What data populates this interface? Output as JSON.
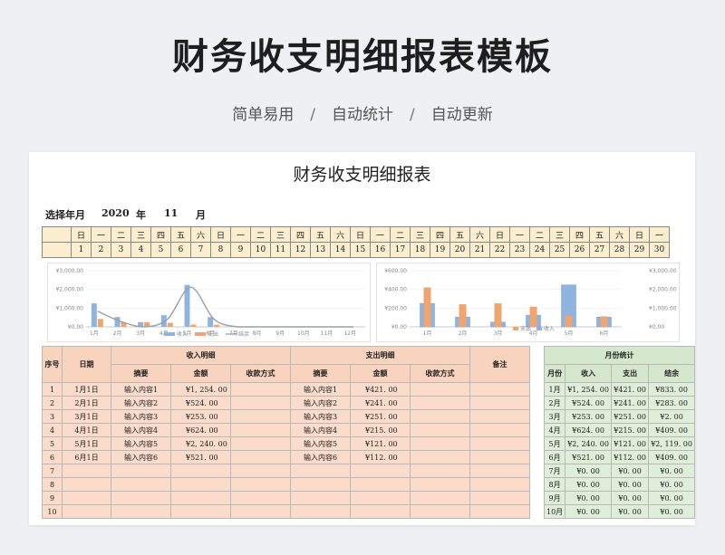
{
  "hero": {
    "title": "财务收支明细报表模板",
    "tags": [
      "简单易用",
      "自动统计",
      "自动更新"
    ],
    "separator": "/"
  },
  "sheet": {
    "title": "财务收支明细报表",
    "picker": {
      "label": "选择年月",
      "year": "2020",
      "year_unit": "年",
      "month": "11",
      "month_unit": "月"
    }
  },
  "calendar": {
    "weekdays": [
      "日",
      "一",
      "二",
      "三",
      "四",
      "五",
      "六",
      "日",
      "一",
      "二",
      "三",
      "四",
      "五",
      "六",
      "日",
      "一",
      "二",
      "三",
      "四",
      "五",
      "六",
      "日",
      "一",
      "二",
      "三",
      "四",
      "五",
      "六",
      "日",
      "一"
    ],
    "days": [
      "1",
      "2",
      "3",
      "4",
      "5",
      "6",
      "7",
      "8",
      "9",
      "10",
      "11",
      "12",
      "13",
      "14",
      "15",
      "16",
      "17",
      "18",
      "19",
      "20",
      "21",
      "22",
      "23",
      "24",
      "25",
      "26",
      "27",
      "28",
      "29",
      "30"
    ]
  },
  "colors": {
    "income": "#8fb4e0",
    "expense": "#f0a46e",
    "balance": "#9aa0a6",
    "calendar": "#fbeecf",
    "ledger": "#fbdccb",
    "summary": "#dfeed9"
  },
  "chart_data": [
    {
      "type": "bar",
      "categories": [
        "1月",
        "2月",
        "3月",
        "4月",
        "5月",
        "6月",
        "7月",
        "8月",
        "9月",
        "10月",
        "11月",
        "12月"
      ],
      "series": [
        {
          "name": "收入",
          "values": [
            1254,
            524,
            253,
            624,
            2240,
            521,
            0,
            0,
            0,
            0,
            0,
            0
          ]
        },
        {
          "name": "支出",
          "values": [
            421,
            241,
            251,
            215,
            121,
            112,
            0,
            0,
            0,
            0,
            0,
            0
          ]
        },
        {
          "name": "结余",
          "values": [
            833,
            283,
            2,
            409,
            2119,
            409,
            0,
            0,
            0,
            0,
            0,
            0
          ]
        }
      ],
      "ylim": [
        0,
        3000
      ],
      "yticks": [
        "¥0.00",
        "¥1,000.00",
        "¥2,000.00",
        "¥3,000.00"
      ]
    },
    {
      "type": "bar",
      "categories": [
        "1月",
        "2月",
        "3月",
        "4月",
        "5月",
        "6月"
      ],
      "series": [
        {
          "name": "收入",
          "values": [
            1254,
            524,
            253,
            624,
            2240,
            521
          ]
        },
        {
          "name": "支出",
          "values": [
            421,
            241,
            251,
            215,
            121,
            112
          ]
        }
      ],
      "left_ylim": [
        0,
        600
      ],
      "left_yticks": [
        "¥0.00",
        "¥200.00",
        "¥400.00",
        "¥600.00"
      ],
      "right_ylim": [
        0,
        3000
      ],
      "right_yticks": [
        "¥0.00",
        "¥1,000.00",
        "¥2,000.00",
        "¥3,000.00"
      ]
    }
  ],
  "ledger": {
    "headers": {
      "seq": "序号",
      "date": "日期",
      "income_group": "收入明细",
      "expense_group": "支出明细",
      "note": "备注",
      "summary": "摘要",
      "amount": "金额",
      "income_method": "收款方式",
      "expense_method": "收款方式"
    },
    "rows": [
      {
        "seq": "1",
        "date": "1月1日",
        "in_desc": "输入内容1",
        "in_amt": "¥1, 254. 00",
        "out_desc": "输入内容1",
        "out_amt": "¥421. 00"
      },
      {
        "seq": "2",
        "date": "2月1日",
        "in_desc": "输入内容2",
        "in_amt": "¥524. 00",
        "out_desc": "输入内容2",
        "out_amt": "¥241. 00"
      },
      {
        "seq": "3",
        "date": "3月1日",
        "in_desc": "输入内容3",
        "in_amt": "¥253. 00",
        "out_desc": "输入内容3",
        "out_amt": "¥251. 00"
      },
      {
        "seq": "4",
        "date": "4月1日",
        "in_desc": "输入内容4",
        "in_amt": "¥624. 00",
        "out_desc": "输入内容4",
        "out_amt": "¥215. 00"
      },
      {
        "seq": "5",
        "date": "5月1日",
        "in_desc": "输入内容5",
        "in_amt": "¥2, 240. 00",
        "out_desc": "输入内容5",
        "out_amt": "¥121. 00"
      },
      {
        "seq": "6",
        "date": "6月1日",
        "in_desc": "输入内容6",
        "in_amt": "¥521. 00",
        "out_desc": "输入内容6",
        "out_amt": "¥112. 00"
      },
      {
        "seq": "7",
        "date": "",
        "in_desc": "",
        "in_amt": "",
        "out_desc": "",
        "out_amt": ""
      },
      {
        "seq": "8",
        "date": "",
        "in_desc": "",
        "in_amt": "",
        "out_desc": "",
        "out_amt": ""
      },
      {
        "seq": "9",
        "date": "",
        "in_desc": "",
        "in_amt": "",
        "out_desc": "",
        "out_amt": ""
      },
      {
        "seq": "10",
        "date": "",
        "in_desc": "",
        "in_amt": "",
        "out_desc": "",
        "out_amt": ""
      }
    ]
  },
  "summary": {
    "title": "月份统计",
    "headers": [
      "月份",
      "收入",
      "支出",
      "结余"
    ],
    "rows": [
      [
        "1月",
        "¥1, 254. 00",
        "¥421. 00",
        "¥833. 00"
      ],
      [
        "2月",
        "¥524. 00",
        "¥241. 00",
        "¥283. 00"
      ],
      [
        "3月",
        "¥253. 00",
        "¥251. 00",
        "¥2. 00"
      ],
      [
        "4月",
        "¥624. 00",
        "¥215. 00",
        "¥409. 00"
      ],
      [
        "5月",
        "¥2, 240. 00",
        "¥121. 00",
        "¥2, 119. 00"
      ],
      [
        "6月",
        "¥521. 00",
        "¥112. 00",
        "¥409. 00"
      ],
      [
        "7月",
        "¥0. 00",
        "¥0. 00",
        "¥0. 00"
      ],
      [
        "8月",
        "¥0. 00",
        "¥0. 00",
        "¥0. 00"
      ],
      [
        "9月",
        "¥0. 00",
        "¥0. 00",
        "¥0. 00"
      ],
      [
        "10月",
        "¥0. 00",
        "¥0. 00",
        "¥0. 00"
      ]
    ]
  }
}
